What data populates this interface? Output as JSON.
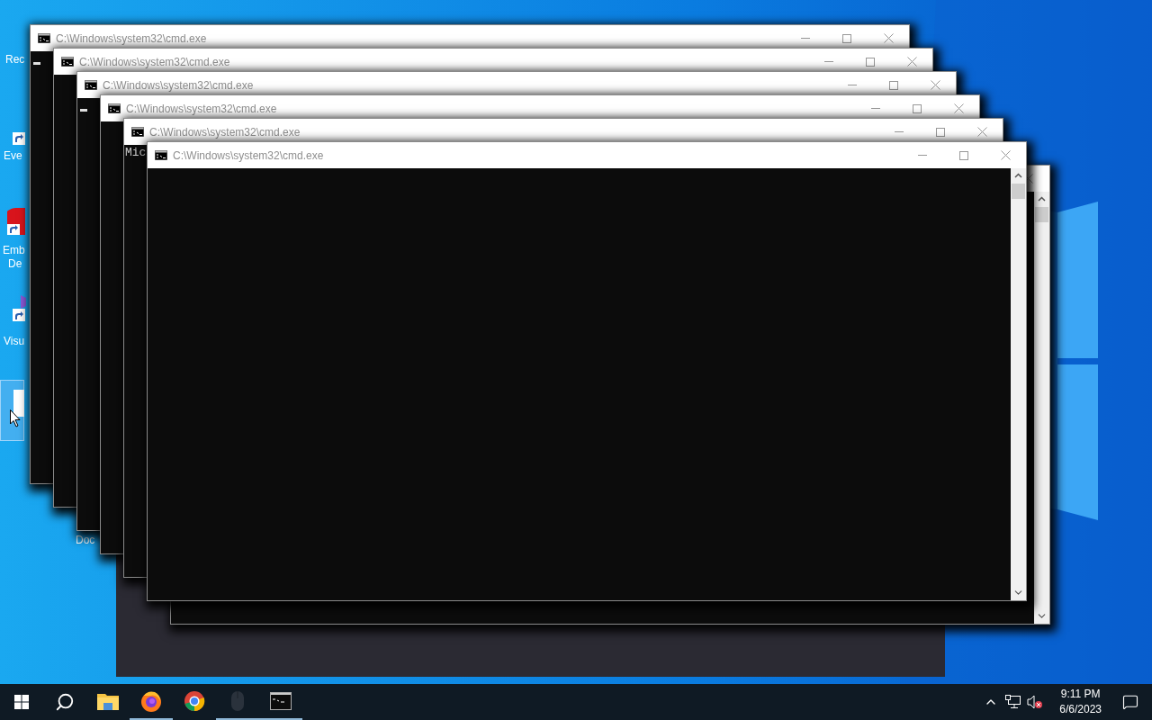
{
  "desktop": {
    "icons": [
      {
        "kind": "label-only",
        "lines": [
          "Rec"
        ],
        "selected": false
      },
      {
        "kind": "shortcut",
        "lines": [
          "Eve"
        ],
        "selected": false
      },
      {
        "kind": "red-shortcut",
        "lines": [
          "Emb",
          "De"
        ],
        "selected": false
      },
      {
        "kind": "purple-shortcut",
        "lines": [
          "Visu"
        ],
        "selected": false
      },
      {
        "kind": "blank",
        "selected": true
      },
      {
        "kind": "label-only",
        "lines": [
          "Doc"
        ],
        "selected": false
      }
    ]
  },
  "windows": [
    {
      "kind": "console",
      "title": "C:\\Windows\\system32\\cmd.exe",
      "cursor": true
    },
    {
      "kind": "console",
      "title": "C:\\Windows\\system32\\cmd.exe"
    },
    {
      "kind": "console",
      "title": "C:\\Windows\\system32\\cmd.exe",
      "cursor": true
    },
    {
      "kind": "console",
      "title": "C:\\Windows\\system32\\cmd.exe"
    },
    {
      "kind": "console",
      "title": "C:\\Windows\\system32\\cmd.exe",
      "lines": [
        "Mic"
      ]
    },
    {
      "kind": "partial",
      "scrollbar": true
    },
    {
      "kind": "console",
      "title": "C:\\Windows\\system32\\cmd.exe",
      "scrollbar": true
    }
  ],
  "taskbar": {
    "apps": [
      {
        "kind": "explorer",
        "running": false
      },
      {
        "kind": "firefox",
        "running": true
      },
      {
        "kind": "chrome",
        "running": false
      },
      {
        "kind": "mouse",
        "running": true
      },
      {
        "kind": "console",
        "running": true
      }
    ],
    "clock": {
      "time": "9:11 PM",
      "date": "6/6/2023"
    }
  }
}
